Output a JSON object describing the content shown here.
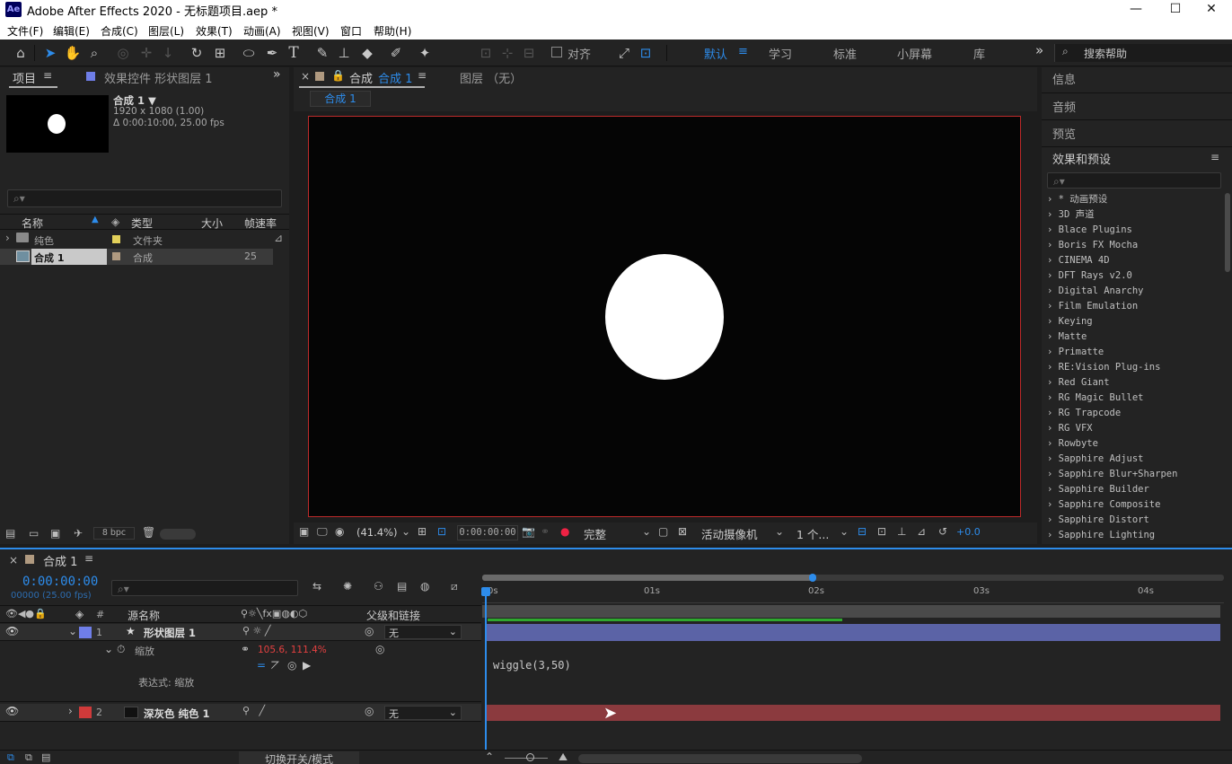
{
  "window": {
    "title": "Adobe After Effects 2020 - 无标题项目.aep *",
    "app_badge": "Ae",
    "minimize": "—",
    "maximize": "☐",
    "close": "✕"
  },
  "menu": [
    "文件(F)",
    "编辑(E)",
    "合成(C)",
    "图层(L)",
    "效果(T)",
    "动画(A)",
    "视图(V)",
    "窗口",
    "帮助(H)"
  ],
  "toolbar": {
    "snap_label": "对齐",
    "workspaces": [
      "默认",
      "学习",
      "标准",
      "小屏幕",
      "库"
    ],
    "active_workspace": "默认",
    "overflow": "»",
    "help_search_placeholder": "搜索帮助"
  },
  "project": {
    "tabs": [
      "项目",
      "效果控件 形状图层 1"
    ],
    "menu_icon": "≡",
    "overflow": "»",
    "thumb": {
      "name": "合成 1 ▼",
      "res": "1920 x 1080 (1.00)",
      "dur": "Δ 0:00:10:00, 25.00 fps"
    },
    "search_placeholder": "",
    "columns": [
      "名称",
      "类型",
      "大小",
      "帧速率"
    ],
    "rows": [
      {
        "name": "纯色",
        "type": "文件夹",
        "size": "",
        "fps": "",
        "color": "#e2d05a"
      },
      {
        "name": "合成 1",
        "type": "合成",
        "size": "",
        "fps": "25",
        "color": "#b09a80"
      }
    ],
    "footer": {
      "bpc": "8 bpc"
    }
  },
  "comp": {
    "tabs": [
      "合成",
      "合成 1",
      "图层 （无）"
    ],
    "close": "×",
    "breadcrumb": "合成 1",
    "viewer_bottom": {
      "zoom": "(41.4%)",
      "timecode": "0:00:00:00",
      "quality": "完整",
      "camera": "活动摄像机",
      "views": "1 个...",
      "exposure": "+0.0"
    }
  },
  "right_panels": {
    "items": [
      "信息",
      "音频",
      "预览",
      "效果和预设"
    ],
    "menu_icon": "≡",
    "effects": [
      "* 动画预设",
      "3D 声道",
      "Blace Plugins",
      "Boris FX Mocha",
      "CINEMA 4D",
      "DFT Rays v2.0",
      "Digital Anarchy",
      "Film Emulation",
      "Keying",
      "Matte",
      "Primatte",
      "RE:Vision Plug-ins",
      "Red Giant",
      "RG Magic Bullet",
      "RG Trapcode",
      "RG VFX",
      "Rowbyte",
      "Sapphire Adjust",
      "Sapphire Blur+Sharpen",
      "Sapphire Builder",
      "Sapphire Composite",
      "Sapphire Distort",
      "Sapphire Lighting"
    ]
  },
  "timeline": {
    "tab": "合成 1",
    "close": "×",
    "menu_icon": "≡",
    "timecode": "0:00:00:00",
    "frames": "00000 (25.00 fps)",
    "columns": {
      "hash": "#",
      "source": "源名称",
      "parent": "父级和链接"
    },
    "ruler": [
      "0s",
      "01s",
      "02s",
      "03s",
      "04s"
    ],
    "layers": [
      {
        "num": "1",
        "name": "形状图层 1",
        "parent": "无",
        "color": "#6f7ee8",
        "bar": "#5a63a8"
      },
      {
        "num": "2",
        "name": "深灰色 纯色 1",
        "parent": "无",
        "color": "#d03a3a",
        "bar": "#8b3a3e"
      }
    ],
    "scale_label": "缩放",
    "scale_value": "105.6, 111.4%",
    "expr_label": "表达式: 缩放",
    "expression": "wiggle(3,50)",
    "footer_toggle": "切换开关/模式"
  }
}
